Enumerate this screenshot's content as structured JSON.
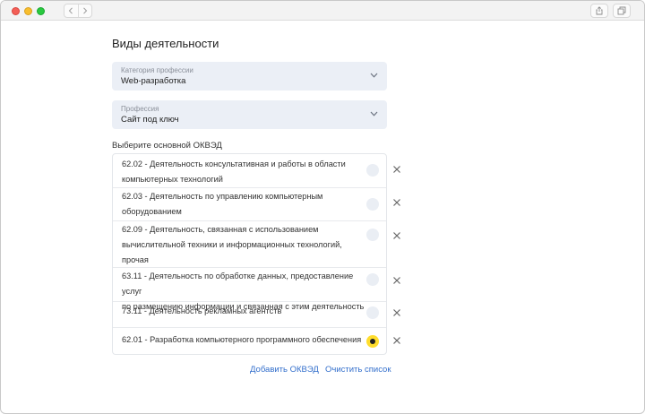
{
  "page": {
    "title": "Виды деятельности"
  },
  "form": {
    "category": {
      "label": "Категория профессии",
      "value": "Web-разработка"
    },
    "profession": {
      "label": "Профессия",
      "value": "Сайт под ключ"
    },
    "okved_label": "Выберите основной ОКВЭД",
    "okved_items": [
      {
        "lines": [
          "62.02 - Деятельность консультативная и работы в области",
          "компьютерных технологий"
        ],
        "selected": false
      },
      {
        "lines": [
          "62.03 - Деятельность по управлению компьютерным",
          "оборудованием"
        ],
        "selected": false
      },
      {
        "lines": [
          "62.09 - Деятельность, связанная с использованием",
          "вычислительной техники и информационных технологий,",
          "прочая"
        ],
        "selected": false
      },
      {
        "lines": [
          "63.11 - Деятельность по обработке данных, предоставление услуг",
          "по размещению информации и связанная с этим деятельность"
        ],
        "selected": false
      },
      {
        "lines": [
          "73.11 - Деятельность рекламных агентств"
        ],
        "selected": false
      },
      {
        "lines": [
          "62.01 - Разработка компьютерного программного обеспечения"
        ],
        "selected": true
      }
    ],
    "add_link": "Добавить ОКВЭД",
    "clear_link": "Очистить список"
  },
  "colors": {
    "accent_radio": "#ffdd2d",
    "link": "#336fcc",
    "select_bg": "#ebeff6"
  }
}
